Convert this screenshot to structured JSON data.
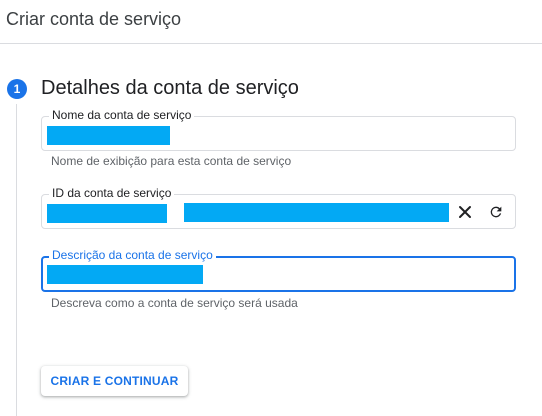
{
  "header": {
    "title": "Criar conta de serviço"
  },
  "step": {
    "number": "1",
    "title": "Detalhes da conta de serviço"
  },
  "fields": {
    "name": {
      "label": "Nome da conta de serviço",
      "hint": "Nome de exibição para esta conta de serviço"
    },
    "id": {
      "label": "ID da conta de serviço"
    },
    "description": {
      "label": "Descrição da conta de serviço",
      "hint": "Descreva como a conta de serviço será usada"
    }
  },
  "icons": {
    "clear": "close-icon",
    "refresh": "refresh-icon"
  },
  "colors": {
    "accent": "#1a73e8",
    "redaction": "#03a9f4"
  },
  "actions": {
    "create_continue": "CRIAR E CONTINUAR"
  }
}
